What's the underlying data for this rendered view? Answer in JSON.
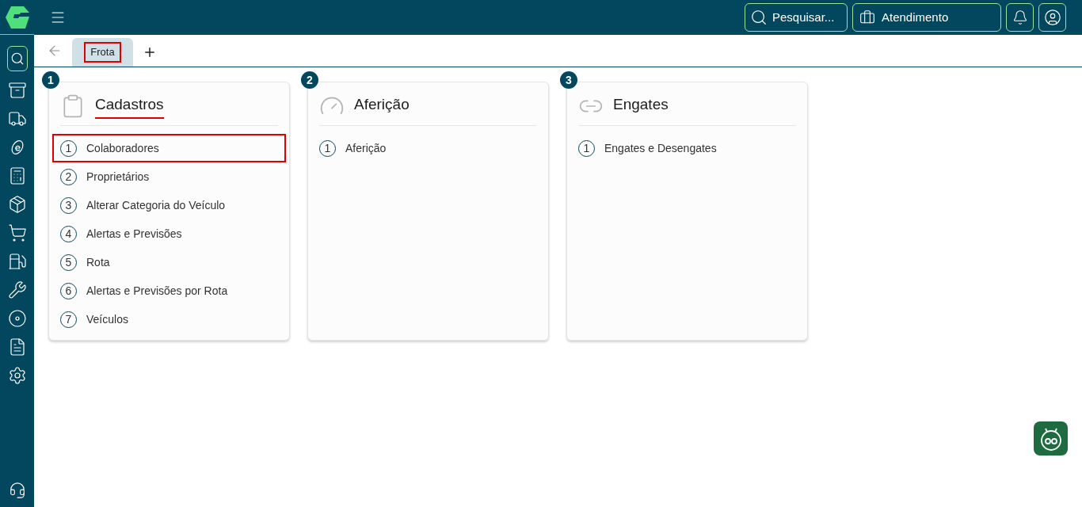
{
  "topbar": {
    "search_label": "Pesquisar...",
    "service_label": "Atendimento"
  },
  "tabs": [
    {
      "label": "Frota",
      "selected": true,
      "highlighted": true
    }
  ],
  "cards": [
    {
      "badge": "1",
      "kind": "clipboard",
      "title": "Cadastros",
      "title_underlined": true,
      "items": [
        {
          "number": "1",
          "label": "Colaboradores",
          "highlighted": true
        },
        {
          "number": "2",
          "label": "Proprietários",
          "highlighted": false
        },
        {
          "number": "3",
          "label": "Alterar Categoria do Veículo",
          "highlighted": false
        },
        {
          "number": "4",
          "label": "Alertas e Previsões",
          "highlighted": false
        },
        {
          "number": "5",
          "label": "Rota",
          "highlighted": false
        },
        {
          "number": "6",
          "label": "Alertas e Previsões por Rota",
          "highlighted": false
        },
        {
          "number": "7",
          "label": "Veículos",
          "highlighted": false
        }
      ]
    },
    {
      "badge": "2",
      "kind": "gauge",
      "title": "Aferição",
      "title_underlined": false,
      "items": [
        {
          "number": "1",
          "label": "Aferição",
          "highlighted": false
        }
      ]
    },
    {
      "badge": "3",
      "kind": "link",
      "title": "Engates",
      "title_underlined": false,
      "items": [
        {
          "number": "1",
          "label": "Engates e Desengates",
          "highlighted": false
        }
      ]
    }
  ]
}
